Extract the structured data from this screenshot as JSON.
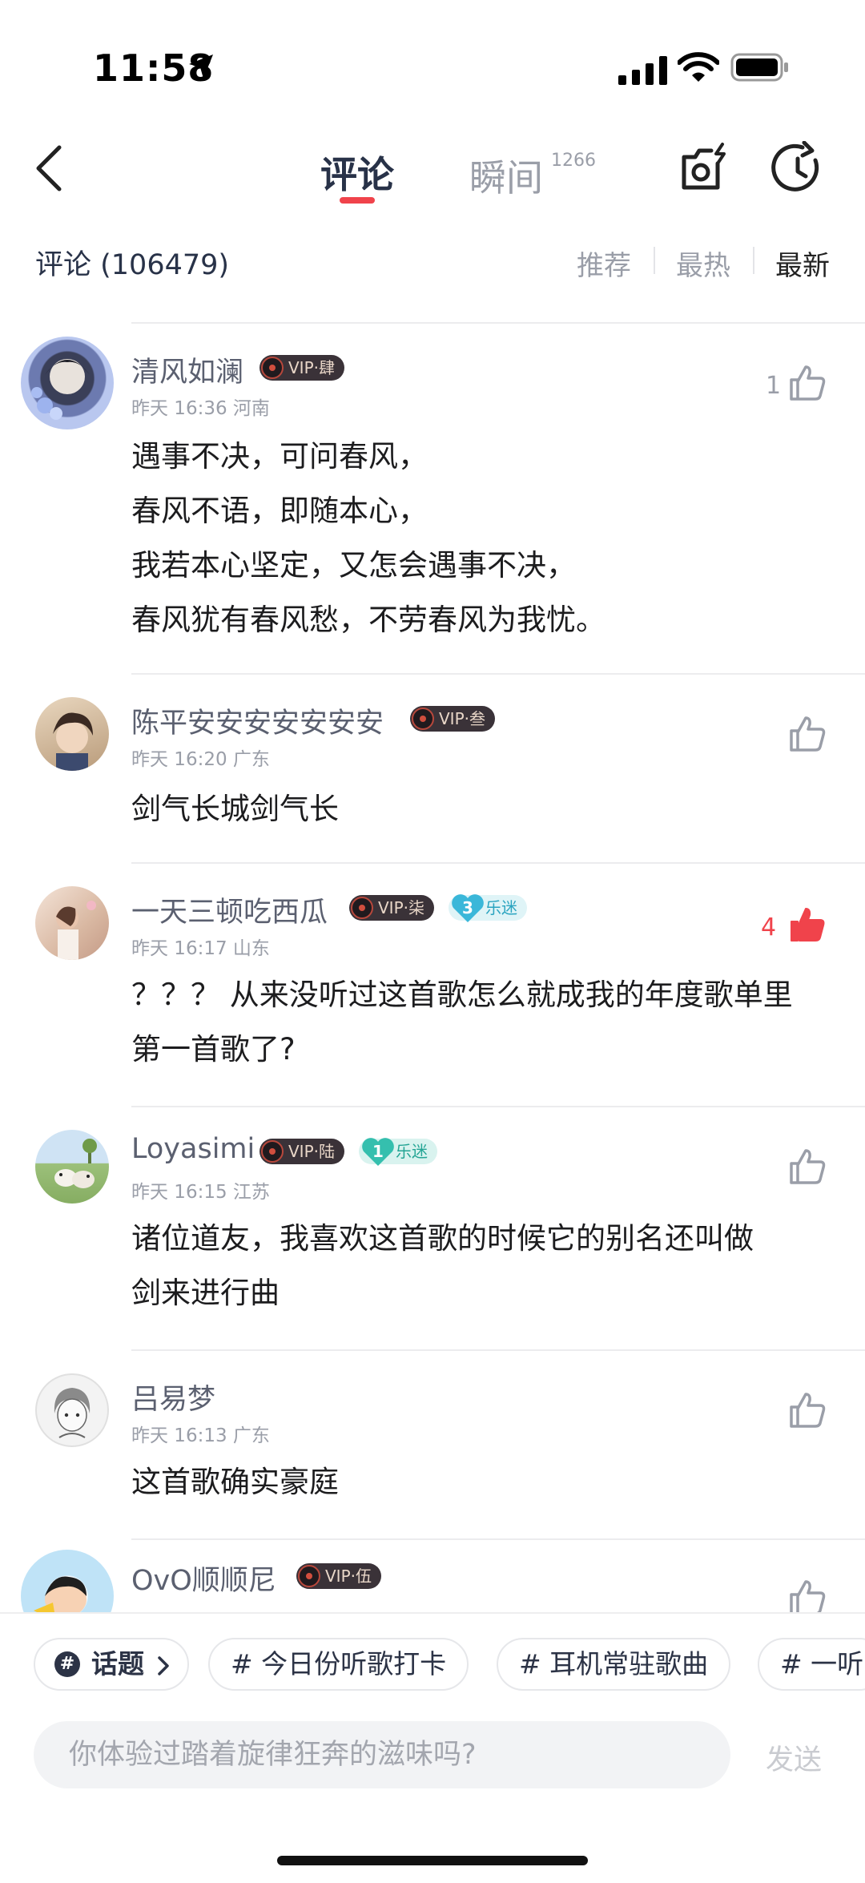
{
  "status_bar": {
    "time": "11:58"
  },
  "header": {
    "tabs": [
      {
        "label": "评论",
        "active": true
      },
      {
        "label": "瞬间",
        "count": "1266",
        "active": false
      }
    ]
  },
  "sort_bar": {
    "comments_count_label": "评论 (106479)",
    "options": [
      "推荐",
      "最热",
      "最新"
    ],
    "active_option": "最新"
  },
  "comments": [
    {
      "username": "清风如澜",
      "vip": "VIP·肆",
      "meta": "昨天 16:36  河南",
      "text": "遇事不决，可问春风，\n春风不语，即随本心，\n我若本心坚定，又怎会遇事不决，\n春风犹有春风愁，不劳春风为我忧。",
      "like_count": "1",
      "liked": false
    },
    {
      "username": "陈平安安安安安安安",
      "vip": "VIP·叁",
      "meta": "昨天 16:20  广东",
      "text": "剑气长城剑气长",
      "like_count": "",
      "liked": false
    },
    {
      "username": "一天三顿吃西瓜",
      "vip": "VIP·柒",
      "fan_level": "3",
      "fan_label": "乐迷",
      "meta": "昨天 16:17  山东",
      "text": "？？？ 从来没听过这首歌怎么就成我的年度歌单里\n第一首歌了?",
      "like_count": "4",
      "liked": true
    },
    {
      "username": "Loyasimi",
      "vip": "VIP·陆",
      "fan_level": "1",
      "fan_label": "乐迷",
      "meta": "昨天 16:15  江苏",
      "text": "诸位道友，我喜欢这首歌的时候它的别名还叫做\n剑来进行曲",
      "like_count": "",
      "liked": false
    },
    {
      "username": "吕易梦",
      "meta": "昨天 16:13  广东",
      "text": "这首歌确实豪庭",
      "like_count": "",
      "liked": false
    },
    {
      "username": "OvO顺顺尼",
      "vip": "VIP·伍",
      "like_count": "",
      "liked": false
    }
  ],
  "topics": {
    "topic_button": "话题",
    "chips": [
      "# 今日份听歌打卡",
      "# 耳机常驻歌曲",
      "# 一听"
    ]
  },
  "composer": {
    "placeholder": "你体验过踏着旋律狂奔的滋味吗?",
    "send_label": "发送"
  },
  "colors": {
    "accent": "#f0434b",
    "title_dark": "#283248",
    "muted": "#9a9ea8"
  }
}
